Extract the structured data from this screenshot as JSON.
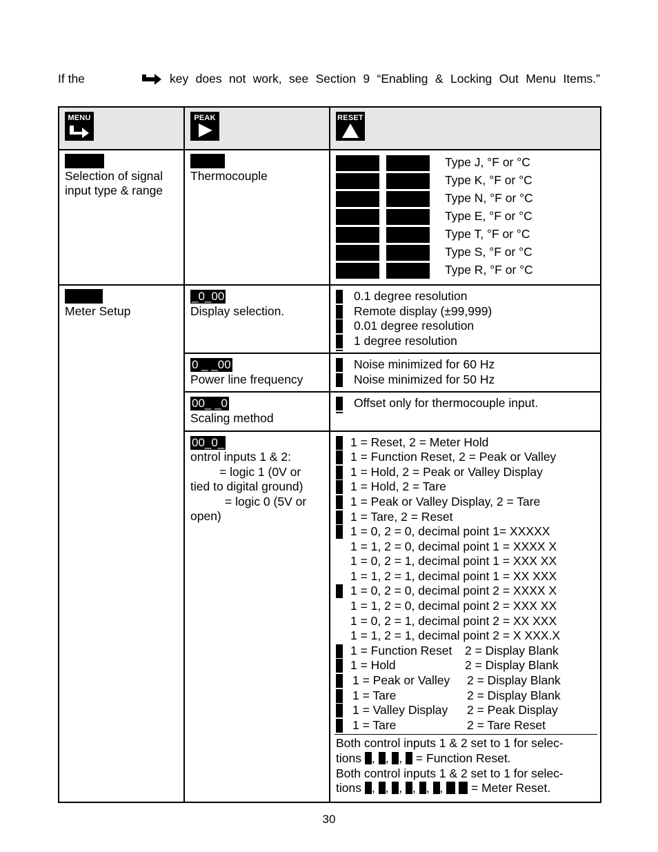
{
  "intro": {
    "prefix": "If the",
    "icon": "menu-arrow-icon",
    "text": "key does not work, see Section 9 “Enabling & Locking Out Menu Items.”"
  },
  "header": {
    "keys": [
      {
        "label": "MENU",
        "icon": "enter-arrow-icon"
      },
      {
        "label": "PEAK",
        "icon": "right-triangle-icon"
      },
      {
        "label": "RESET",
        "icon": "up-triangle-icon"
      }
    ]
  },
  "rows": {
    "input": {
      "menu_desc": "Selection of signal input type & range",
      "peak_desc": "Thermocouple",
      "types": [
        "Type J, °F or °C",
        "Type K, °F or °C",
        "Type N, °F or °C",
        "Type E, °F or °C",
        "Type T, °F or °C",
        "Type S, °F or °C",
        "Type R, °F or °C"
      ]
    },
    "setup": {
      "menu_desc": "Meter Setup",
      "display": {
        "code": "_0_00",
        "desc": "Display selection.",
        "options": [
          "0.1 degree resolution",
          "Remote display (±99,999)",
          "0.01 degree resolution",
          "1 degree resolution"
        ]
      },
      "power": {
        "code": "0 _ _00",
        "desc": "Power line frequency",
        "options": [
          "Noise minimized for 60 Hz",
          "Noise minimized for 50 Hz"
        ]
      },
      "scaling": {
        "code": "00_ _0",
        "desc": "Scaling method",
        "options": [
          "Offset only for thermocouple input."
        ]
      },
      "control": {
        "code": "00_0_",
        "desc_line1": "ontrol inputs 1 & 2:",
        "desc_line2": "= logic 1 (0V or",
        "desc_line3": "tied to digital ground)",
        "desc_line4": "= logic 0 (5V or",
        "desc_line5": "open)",
        "options": [
          {
            "marker": true,
            "text": "1 = Reset, 2 = Meter Hold"
          },
          {
            "marker": true,
            "text": "1 = Function Reset, 2 = Peak or Valley"
          },
          {
            "marker": true,
            "text": "1 = Hold, 2 = Peak or Valley Display"
          },
          {
            "marker": true,
            "text": "1 = Hold, 2 = Tare"
          },
          {
            "marker": true,
            "text": "1 = Peak or Valley Display, 2 = Tare"
          },
          {
            "marker": true,
            "text": "1 = Tare, 2 = Reset"
          },
          {
            "marker": true,
            "text": "1 = 0, 2 = 0, decimal point 1= XXXXX"
          },
          {
            "marker": false,
            "text": "1 = 1, 2 = 0, decimal point 1 = XXXX X"
          },
          {
            "marker": false,
            "text": "1 = 0, 2 = 1, decimal point 1 = XXX XX"
          },
          {
            "marker": false,
            "text": "1 = 1, 2 = 1, decimal point 1 = XX XXX"
          },
          {
            "marker": true,
            "text": "1 = 0, 2 = 0, decimal point 2 = XXXX X"
          },
          {
            "marker": false,
            "text": "1 = 1, 2 = 0, decimal point 2 = XXX XX"
          },
          {
            "marker": false,
            "text": "1 = 0, 2 = 1, decimal point 2 = XX XXX"
          },
          {
            "marker": false,
            "text": "1 = 1, 2 = 1, decimal point 2 = X XXX.X"
          }
        ],
        "pairs": [
          {
            "a": "1 = Function Reset",
            "b": "2 = Display Blank"
          },
          {
            "a": "1 = Hold",
            "b": "2 = Display Blank"
          },
          {
            "a": "1 = Peak or Valley",
            "b": "2 = Display Blank"
          },
          {
            "a": "1 = Tare",
            "b": "2 = Display Blank"
          },
          {
            "a": "1 = Valley Display",
            "b": "2 =  Peak Display"
          },
          {
            "a": "1 = Tare",
            "b": "2 = Tare Reset"
          }
        ],
        "note1_line1": "Both control inputs 1 & 2 set to 1 for selec-",
        "note1_prefix": "tions",
        "note1_suffix": "= Function Reset.",
        "note2_line1": "Both control inputs 1 & 2 set to 1 for selec-",
        "note2_prefix": "tions",
        "note2_suffix": "= Meter Reset."
      }
    }
  },
  "page_number": "30"
}
